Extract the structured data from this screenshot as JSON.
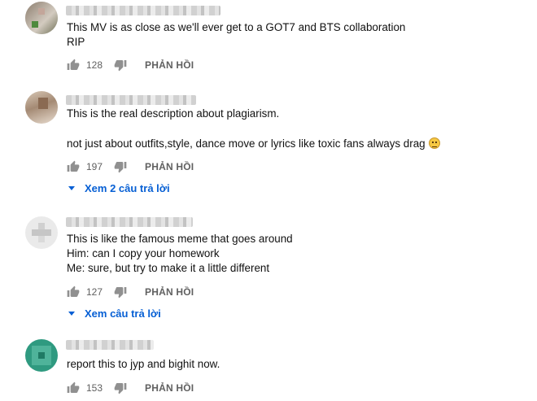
{
  "comments": [
    {
      "lines": [
        "This MV is as close as we'll ever get to a GOT7 and BTS collaboration",
        "RIP"
      ],
      "likes": "128",
      "reply_label": "PHẢN HỒI",
      "replies_label": ""
    },
    {
      "lines": [
        "This is the real description about plagiarism.",
        "",
        "not just about outfits,style, dance move or lyrics like toxic fans always drag"
      ],
      "likes": "197",
      "reply_label": "PHẢN HỒI",
      "replies_label": "Xem 2 câu trả lời"
    },
    {
      "lines": [
        "This is like the famous meme that goes around",
        "Him: can I copy your homework",
        "Me: sure, but try to make it a little different"
      ],
      "likes": "127",
      "reply_label": "PHẢN HỒI",
      "replies_label": "Xem câu trả lời"
    },
    {
      "lines": [
        "report this to jyp and bighit now."
      ],
      "likes": "153",
      "reply_label": "PHẢN HỒI",
      "replies_label": ""
    }
  ],
  "icons": {
    "like": "thumbs-up-icon",
    "dislike": "thumbs-down-icon",
    "expand": "caret-down-icon",
    "emoji": "grinning-face-emoji"
  },
  "colors": {
    "link": "#065fd4",
    "muted": "#606060",
    "text": "#111111"
  }
}
